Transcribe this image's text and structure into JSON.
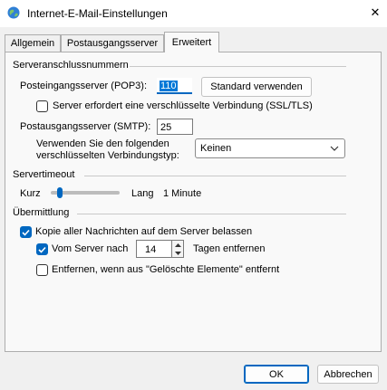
{
  "window": {
    "title": "Internet-E-Mail-Einstellungen",
    "close_glyph": "✕"
  },
  "tabs": [
    {
      "label": "Allgemein"
    },
    {
      "label": "Postausgangsserver"
    },
    {
      "label": "Erweitert"
    }
  ],
  "server_ports": {
    "heading": "Serveranschlussnummern",
    "incoming_label": "Posteingangsserver (POP3):",
    "incoming_value": "110",
    "default_button": "Standard verwenden",
    "ssl_label": "Server erfordert eine verschlüsselte Verbindung (SSL/TLS)",
    "ssl_checked": false,
    "outgoing_label": "Postausgangsserver (SMTP):",
    "outgoing_value": "25",
    "encryption_label_line1": "Verwenden Sie den folgenden",
    "encryption_label_line2": "verschlüsselten Verbindungstyp:",
    "encryption_value": "Keinen"
  },
  "timeout": {
    "heading": "Servertimeout",
    "short_label": "Kurz",
    "long_label": "Lang",
    "value_text": "1 Minute",
    "slider_level": 0.1
  },
  "delivery": {
    "heading": "Übermittlung",
    "keep_copy_label": "Kopie aller Nachrichten auf dem Server belassen",
    "keep_copy_checked": true,
    "remove_after_label": "Vom Server nach",
    "remove_after_checked": true,
    "remove_after_days": "14",
    "days_suffix": "Tagen entfernen",
    "remove_deleted_label": "Entfernen, wenn aus \"Gelöschte Elemente\" entfernt",
    "remove_deleted_checked": false
  },
  "footer": {
    "ok": "OK",
    "cancel": "Abbrechen"
  },
  "colors": {
    "accent": "#0067c0",
    "selection": "#0078d7"
  }
}
